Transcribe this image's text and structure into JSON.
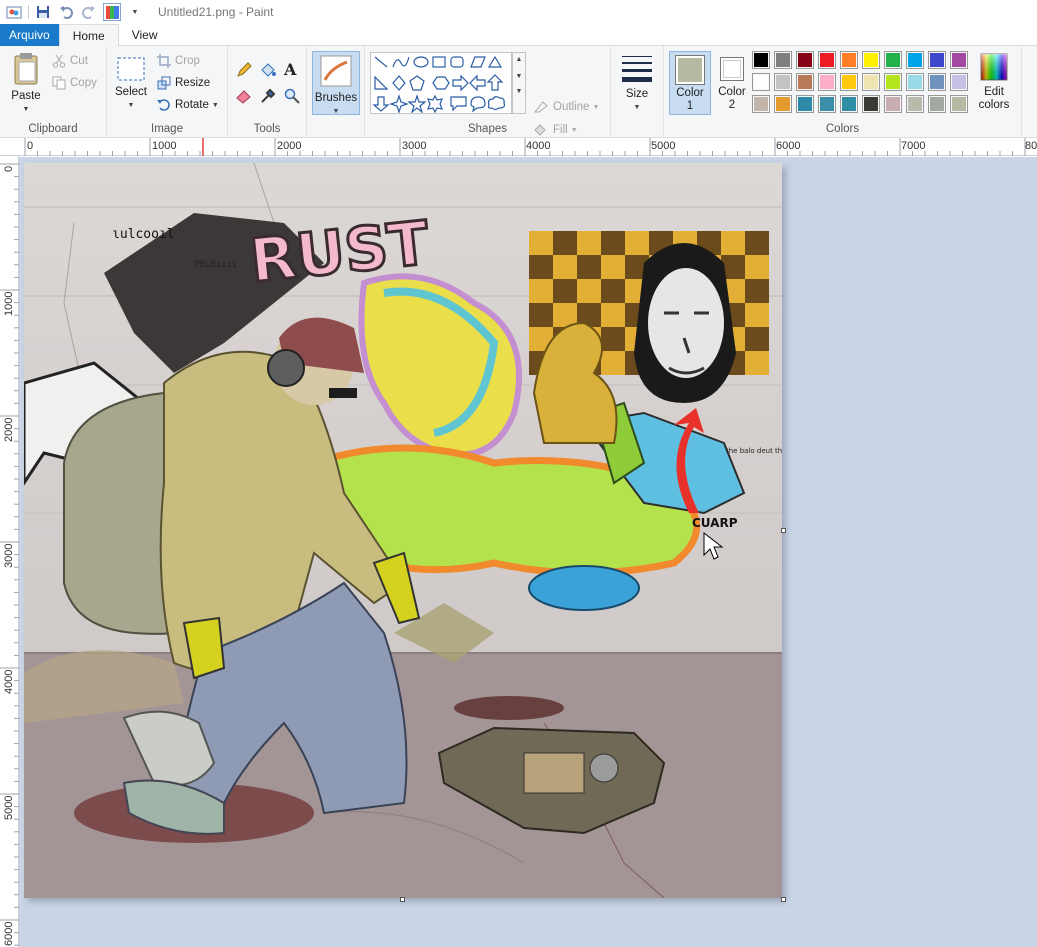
{
  "title_bar": {
    "title": "Untitled21.png - Paint"
  },
  "tabs": [
    {
      "label": "Arquivo"
    },
    {
      "label": "Home"
    },
    {
      "label": "View"
    }
  ],
  "ribbon": {
    "clipboard": {
      "group_label": "Clipboard",
      "paste": "Paste",
      "cut": "Cut",
      "copy": "Copy"
    },
    "image": {
      "group_label": "Image",
      "select": "Select",
      "crop": "Crop",
      "resize": "Resize",
      "rotate": "Rotate"
    },
    "tools": {
      "group_label": "Tools"
    },
    "brushes": {
      "label": "Brushes"
    },
    "shapes": {
      "group_label": "Shapes",
      "outline": "Outline",
      "fill": "Fill"
    },
    "size": {
      "label": "Size"
    },
    "colors": {
      "group_label": "Colors",
      "color1_label": "Color",
      "color1_index": "1",
      "color2_label": "Color",
      "color2_index": "2",
      "edit_label_1": "Edit",
      "edit_label_2": "colors",
      "color1_value": "#b8b9a3",
      "color2_value": "#ffffff",
      "palette_row1": [
        "#000000",
        "#7f7f7f",
        "#880015",
        "#ed1c24",
        "#ff7f27",
        "#fff200",
        "#22b14c",
        "#00a2e8",
        "#3f48cc",
        "#a349a4"
      ],
      "palette_row2": [
        "#ffffff",
        "#c3c3c3",
        "#b97a57",
        "#ffaec9",
        "#ffc90e",
        "#efe4b0",
        "#b5e61d",
        "#99d9ea",
        "#7092be",
        "#c8bfe7"
      ],
      "palette_row3": [
        "#c2b6ad",
        "#e59a2e",
        "#2e8aa8",
        "#3b8ea8",
        "#2e8ca5",
        "#3a3a35",
        "#c9adb0",
        "#b9bbab",
        "#a3a9a0",
        "#b8b9a3"
      ]
    }
  },
  "rulers": {
    "horizontal": [
      "0",
      "1000",
      "2000",
      "3000",
      "4000",
      "5000",
      "6000",
      "7000",
      "80"
    ],
    "vertical": [
      "0",
      "1000",
      "2000",
      "3000",
      "4000",
      "5000",
      "6000"
    ]
  },
  "canvas": {
    "graffiti_rust": "RUST",
    "tag_top_left": "ɩulcooıl",
    "tag_small": "ƱBL8ıııı",
    "tag_cuarp": "CUARP",
    "wall_note": "the balo deut the bı"
  }
}
